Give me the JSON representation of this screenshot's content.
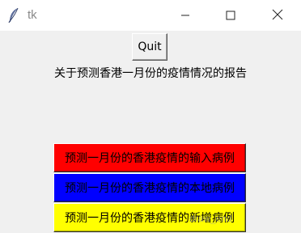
{
  "window": {
    "title": "tk",
    "controls": {
      "minimize_icon": "minimize-icon",
      "maximize_icon": "maximize-icon",
      "close_icon": "close-icon"
    }
  },
  "main": {
    "quit_label": "Quit",
    "report_title": "关于预测香港一月份的疫情情况的报告",
    "buttons": [
      {
        "label": "预测一月份的香港疫情的输入病例",
        "color": "#ff0000"
      },
      {
        "label": "预测一月份的香港疫情的本地病例",
        "color": "#0000ff"
      },
      {
        "label": "预测一月份的香港疫情的新增病例",
        "color": "#ffff00"
      }
    ]
  },
  "watermark": "draw_end"
}
